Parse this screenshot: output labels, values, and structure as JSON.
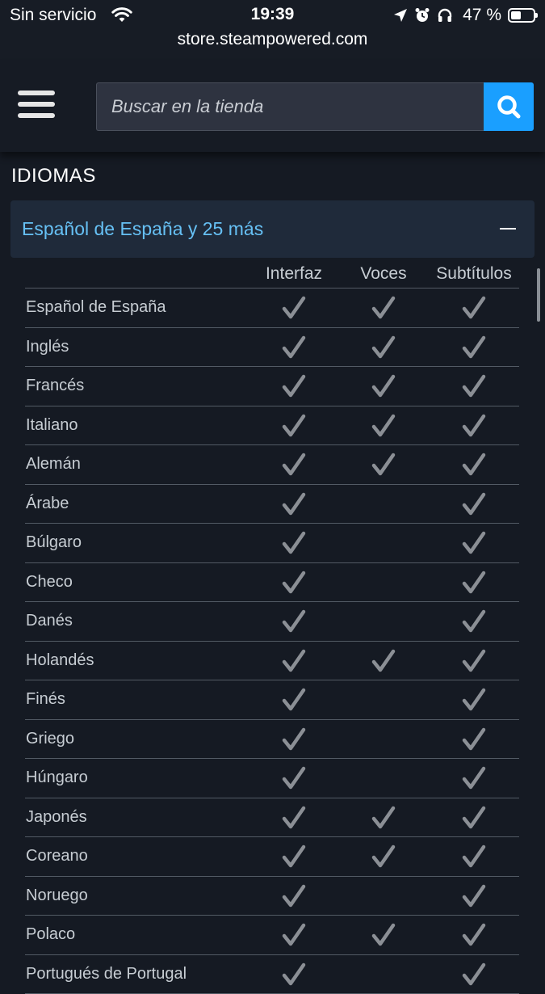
{
  "status_bar": {
    "carrier": "Sin servicio",
    "time": "19:39",
    "battery_percent": "47 %",
    "battery_level": 0.47
  },
  "browser": {
    "url": "store.steampowered.com"
  },
  "header": {
    "search_placeholder": "Buscar en la tienda"
  },
  "languages": {
    "section_title": "IDIOMAS",
    "summary": "Español de España y 25 más",
    "columns": [
      "Interfaz",
      "Voces",
      "Subtítulos"
    ],
    "rows": [
      {
        "name": "Español de España",
        "interface": true,
        "voices": true,
        "subtitles": true
      },
      {
        "name": "Inglés",
        "interface": true,
        "voices": true,
        "subtitles": true
      },
      {
        "name": "Francés",
        "interface": true,
        "voices": true,
        "subtitles": true
      },
      {
        "name": "Italiano",
        "interface": true,
        "voices": true,
        "subtitles": true
      },
      {
        "name": "Alemán",
        "interface": true,
        "voices": true,
        "subtitles": true
      },
      {
        "name": "Árabe",
        "interface": true,
        "voices": false,
        "subtitles": true
      },
      {
        "name": "Búlgaro",
        "interface": true,
        "voices": false,
        "subtitles": true
      },
      {
        "name": "Checo",
        "interface": true,
        "voices": false,
        "subtitles": true
      },
      {
        "name": "Danés",
        "interface": true,
        "voices": false,
        "subtitles": true
      },
      {
        "name": "Holandés",
        "interface": true,
        "voices": true,
        "subtitles": true
      },
      {
        "name": "Finés",
        "interface": true,
        "voices": false,
        "subtitles": true
      },
      {
        "name": "Griego",
        "interface": true,
        "voices": false,
        "subtitles": true
      },
      {
        "name": "Húngaro",
        "interface": true,
        "voices": false,
        "subtitles": true
      },
      {
        "name": "Japonés",
        "interface": true,
        "voices": true,
        "subtitles": true
      },
      {
        "name": "Coreano",
        "interface": true,
        "voices": true,
        "subtitles": true
      },
      {
        "name": "Noruego",
        "interface": true,
        "voices": false,
        "subtitles": true
      },
      {
        "name": "Polaco",
        "interface": true,
        "voices": true,
        "subtitles": true
      },
      {
        "name": "Portugués de Portugal",
        "interface": true,
        "voices": false,
        "subtitles": true
      }
    ]
  },
  "colors": {
    "background": "#151a23",
    "accent": "#1a9fff",
    "link": "#66c0f4",
    "check": "#8b8f95"
  },
  "icons": [
    "wifi-icon",
    "location-arrow-icon",
    "alarm-icon",
    "headphones-icon",
    "battery-icon",
    "hamburger-menu-icon",
    "search-icon",
    "minus-icon",
    "checkmark-icon"
  ]
}
